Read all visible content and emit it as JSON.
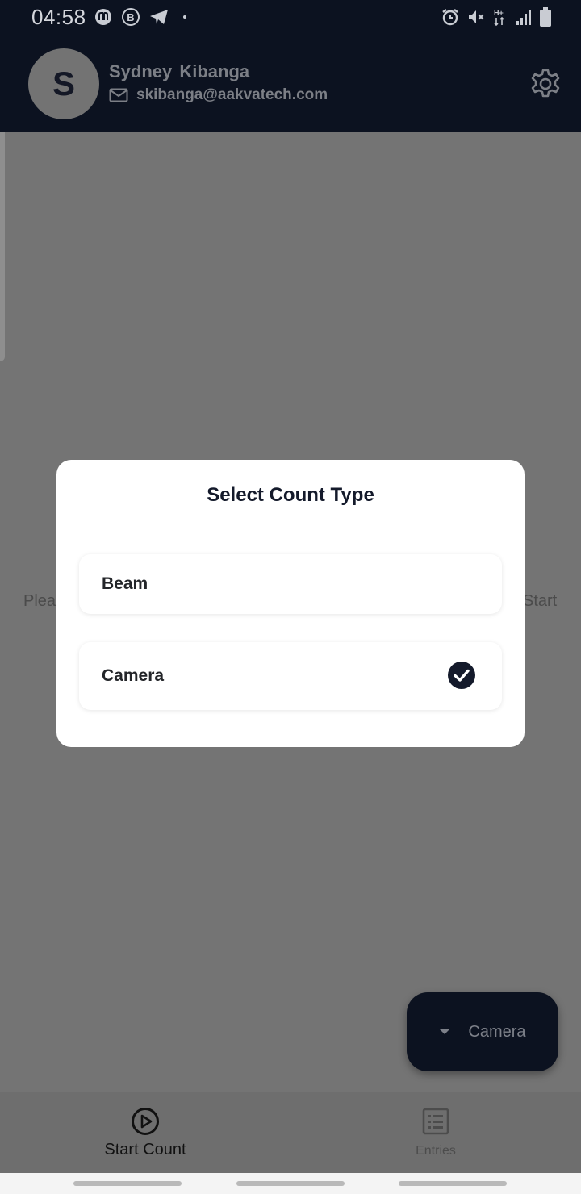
{
  "status_bar": {
    "time": "04:58",
    "left_icons": [
      "notification-app-icon",
      "b-circle-icon",
      "telegram-icon",
      "dot-icon"
    ],
    "right_icons": [
      "alarm-icon",
      "mute-icon",
      "network-hplus-icon",
      "signal-icon",
      "battery-icon"
    ]
  },
  "header": {
    "avatar_initial": "S",
    "user_name": "Sydney Kibanga",
    "user_email": "skibanga@aakvatech.com"
  },
  "background": {
    "left_peek_text": "Plea",
    "right_peek_text": "Start"
  },
  "dialog": {
    "title": "Select Count Type",
    "options": [
      {
        "label": "Beam",
        "selected": false
      },
      {
        "label": "Camera",
        "selected": true
      }
    ]
  },
  "fab": {
    "label": "Camera"
  },
  "bottom_nav": {
    "items": [
      {
        "label": "Start Count",
        "icon": "play-circle-icon",
        "active": true
      },
      {
        "label": "Entries",
        "icon": "list-icon",
        "active": false
      }
    ]
  },
  "colors": {
    "header_bg": "#0c1220",
    "scrim_bg": "#747474",
    "accent": "#141a2b"
  }
}
